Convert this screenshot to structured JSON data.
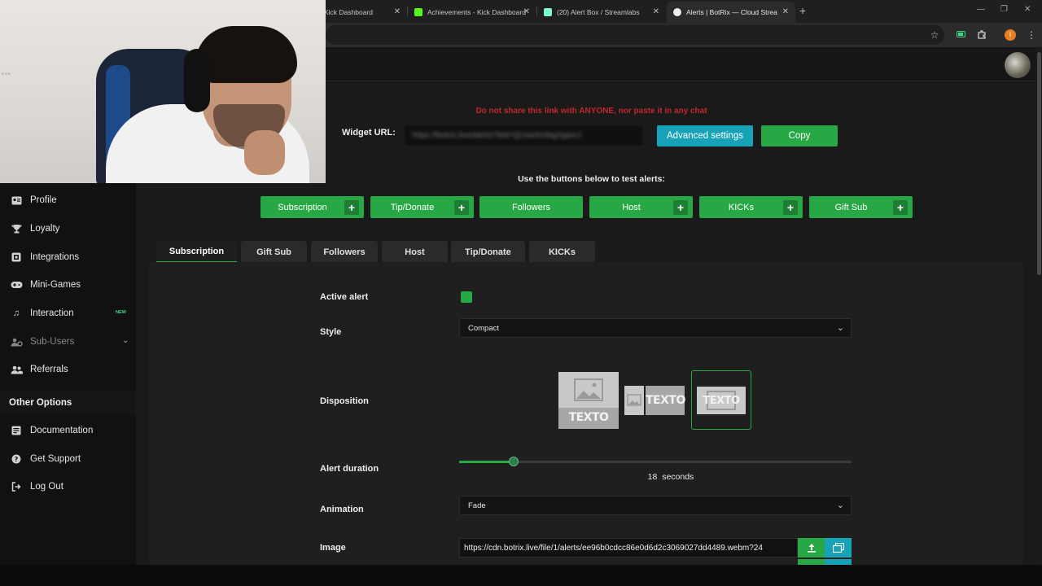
{
  "browser": {
    "tabs": [
      {
        "title": "Kick Dashboard"
      },
      {
        "title": "Achievements - Kick Dashboard"
      },
      {
        "title": "(20) Alert Box / Streamlabs"
      },
      {
        "title": "Alerts | BotRix — Cloud Stream"
      }
    ],
    "new_tab_label": "+",
    "window_controls": {
      "minimize": "—",
      "restore": "❐",
      "close": "✕"
    }
  },
  "sidebar": {
    "items": [
      {
        "label": "Profile",
        "icon": "profile-card-icon"
      },
      {
        "label": "Loyalty",
        "icon": "trophy-icon"
      },
      {
        "label": "Integrations",
        "icon": "integrations-icon"
      },
      {
        "label": "Mini-Games",
        "icon": "gamepad-icon"
      },
      {
        "label": "Interaction",
        "icon": "music-note-icon",
        "badge": "NEW"
      },
      {
        "label": "Sub-Users",
        "icon": "users-gear-icon"
      },
      {
        "label": "Referrals",
        "icon": "users-icon"
      }
    ],
    "other_title": "Other Options",
    "other_items": [
      {
        "label": "Documentation",
        "icon": "document-icon"
      },
      {
        "label": "Get Support",
        "icon": "question-icon"
      },
      {
        "label": "Log Out",
        "icon": "logout-icon"
      }
    ]
  },
  "main": {
    "warning": "Do not share this link with ANYONE, nor paste it in any chat",
    "widget_url_label": "Widget URL:",
    "widget_url_value": "https://botrix.live/alerts?bid=QUxwXmbgXgwoJ",
    "advanced_settings": "Advanced settings",
    "copy": "Copy",
    "test_label": "Use the buttons below to test alerts:",
    "test_buttons": [
      {
        "label": "Subscription",
        "plus": "+"
      },
      {
        "label": "Tip/Donate",
        "plus": "+"
      },
      {
        "label": "Followers",
        "plus": ""
      },
      {
        "label": "Host",
        "plus": "+"
      },
      {
        "label": "KICKs",
        "plus": "+"
      },
      {
        "label": "Gift Sub",
        "plus": "+"
      }
    ],
    "tabs": [
      {
        "label": "Subscription",
        "active": true
      },
      {
        "label": "Gift Sub"
      },
      {
        "label": "Followers"
      },
      {
        "label": "Host"
      },
      {
        "label": "Tip/Donate"
      },
      {
        "label": "KICKs"
      }
    ]
  },
  "settings": {
    "active_alert_label": "Active alert",
    "active_alert_checked": true,
    "style_label": "Style",
    "style_value": "Compact",
    "disposition_label": "Disposition",
    "disposition_text": "TEXTO",
    "disposition_selected": 3,
    "alert_duration_label": "Alert duration",
    "alert_duration_value": "18",
    "alert_duration_unit": "seconds",
    "alert_duration_fraction": 0.14,
    "animation_label": "Animation",
    "animation_value": "Fade",
    "image_label": "Image",
    "image_value": "https://cdn.botrix.live/file/1/alerts/ee96b0cdcc86e0d6d2c3069027dd4489.webm?24"
  },
  "colors": {
    "accent": "#28a745",
    "info": "#17a2b8",
    "warning_text": "#c1272d"
  }
}
